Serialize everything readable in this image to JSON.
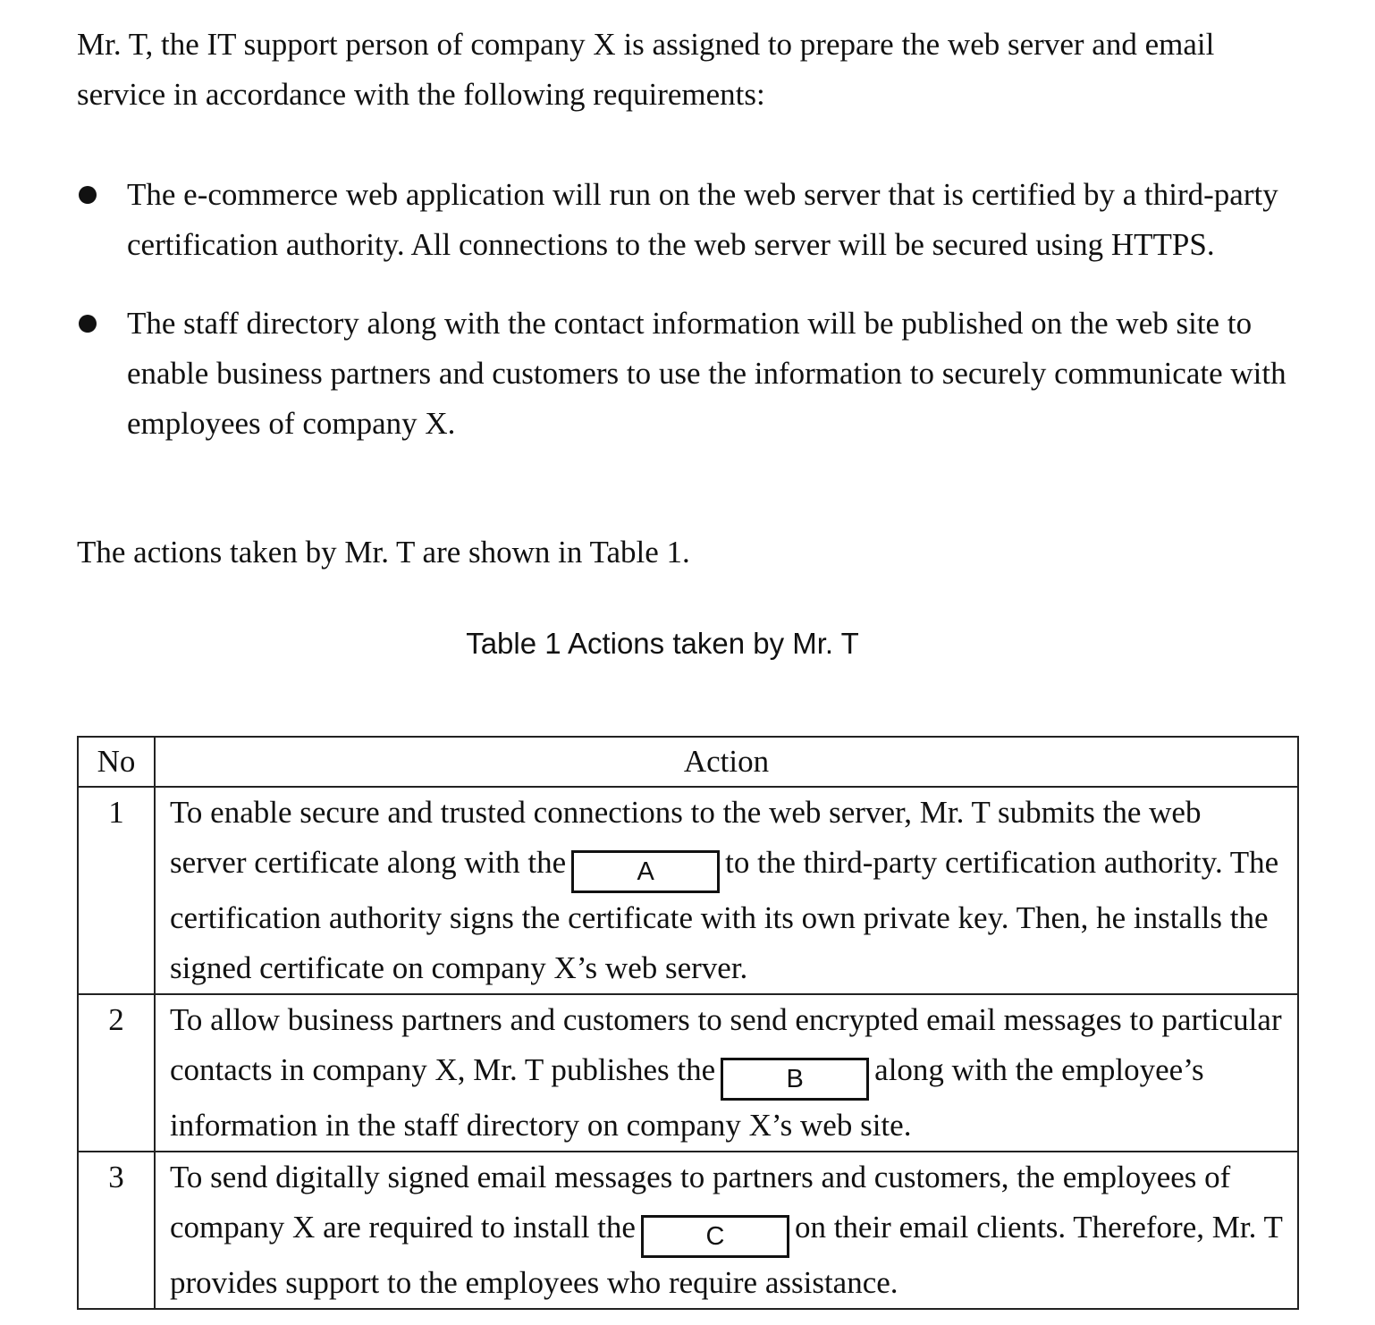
{
  "intro": "Mr. T, the IT support person of company X is assigned to prepare the web server and email service in accordance with the following requirements:",
  "bullets": [
    "The e-commerce web application will run on the web server that is certified by a third-party certification authority. All connections to the web server will be secured using HTTPS.",
    "The staff directory along with the contact information will be published on the web site to enable business partners and customers to use the information to securely communicate with employees of company X."
  ],
  "lead": "The actions taken by Mr. T are shown in Table 1.",
  "table": {
    "caption": "Table 1  Actions taken by Mr. T",
    "headers": [
      "No",
      "Action"
    ],
    "rows": [
      {
        "no": "1",
        "before": "To enable secure and trusted connections to the web server, Mr. T submits the web server certificate along with the",
        "blank": "A",
        "after": "to the third-party certification authority. The certification authority signs the certificate with its own private key. Then, he installs the signed certificate on company X’s web server."
      },
      {
        "no": "2",
        "before": "To allow business partners and customers to send encrypted email messages to particular contacts in company X, Mr. T publishes the",
        "blank": "B",
        "after": "along with the employee’s information in the staff directory on company X’s web site."
      },
      {
        "no": "3",
        "before": "To send digitally signed email messages to partners and customers, the employees of company X are required to install the",
        "blank": "C",
        "after": "on their email clients. Therefore, Mr. T provides support to the employees who require assistance."
      }
    ]
  }
}
